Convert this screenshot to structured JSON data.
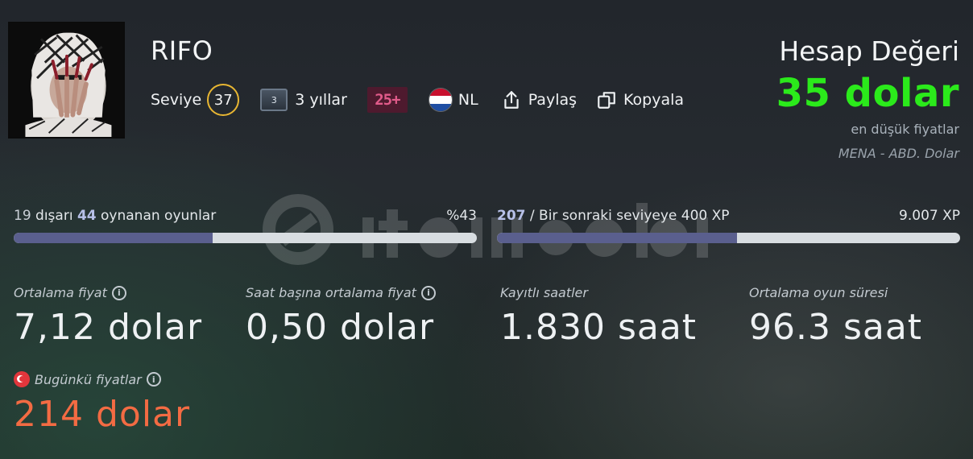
{
  "profile": {
    "username": "RIFO",
    "level_label": "Seviye",
    "level": "37",
    "years_icon_value": "3",
    "years_label": "3 yıllar",
    "age_badge": "25+",
    "country": "NL",
    "share_label": "Paylaş",
    "copy_label": "Kopyala"
  },
  "account_value": {
    "title": "Hesap Değeri",
    "amount": "35 dolar",
    "subtitle": "en düşük fiyatlar",
    "region": "MENA - ABD. Dolar",
    "amount_color": "#2bea1b"
  },
  "games_progress": {
    "played": "19",
    "sep": " dışarı ",
    "total": "44",
    "suffix": " oynanan oyunlar",
    "percent_label": "%43",
    "fraction": 0.43
  },
  "xp_progress": {
    "current": "207",
    "text": " / Bir sonraki seviyeye 400 XP",
    "total_label": "9.007 XP",
    "fraction": 0.5175
  },
  "stats": [
    {
      "label": "Ortalama fiyat",
      "value": "7,12 dolar"
    },
    {
      "label": "Saat başına ortalama fiyat",
      "value": "0,50 dolar"
    },
    {
      "label": "Kayıtlı saatler",
      "value": "1.830 saat"
    },
    {
      "label": "Ortalama oyun süresi",
      "value": "96.3 saat"
    }
  ],
  "today": {
    "label": "Bugünkü fiyatlar",
    "value": "214 dolar",
    "color": "#f36b43"
  },
  "icons": [
    "share-icon",
    "copy-icon",
    "info-icon",
    "netherlands-flag-icon",
    "turkey-flag-icon",
    "years-badge-icon"
  ]
}
